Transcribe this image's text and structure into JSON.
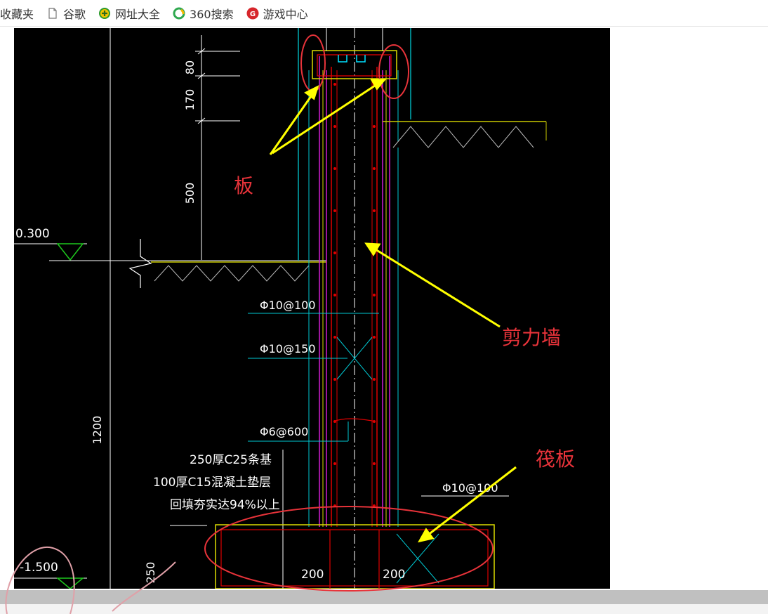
{
  "bookmarks": {
    "favorites": "收藏夹",
    "google": "谷歌",
    "url_directory": "网址大全",
    "search360": "360搜索",
    "game_center": "游戏中心"
  },
  "drawing": {
    "dims": {
      "d80": "80",
      "d170": "170",
      "d500": "500",
      "d1200": "1200",
      "d250": "250",
      "d200a": "200",
      "d200b": "200"
    },
    "elevations": {
      "top": "0.300",
      "bottom": "-1.500"
    },
    "rebar": {
      "r1": "Φ10@100",
      "r2": "Φ10@150",
      "r3": "Φ6@600",
      "r4": "Φ10@100"
    },
    "notes": {
      "line1": "250厚C25条基",
      "line2": "100厚C15混凝土垫层",
      "line3": "回填夯实达94%以上"
    },
    "annotations": {
      "slab": "板",
      "shear_wall": "剪力墙",
      "raft": "筏板"
    },
    "colors": {
      "cad_bg": "#000000",
      "annotation_red": "#e8333a",
      "arrow_yellow": "#ffff00",
      "magenta": "#d21ed2",
      "cyan": "#00c8d2",
      "red_line": "#e00000",
      "yellow_line": "#dcdc00",
      "white_line": "#ffffff"
    }
  }
}
